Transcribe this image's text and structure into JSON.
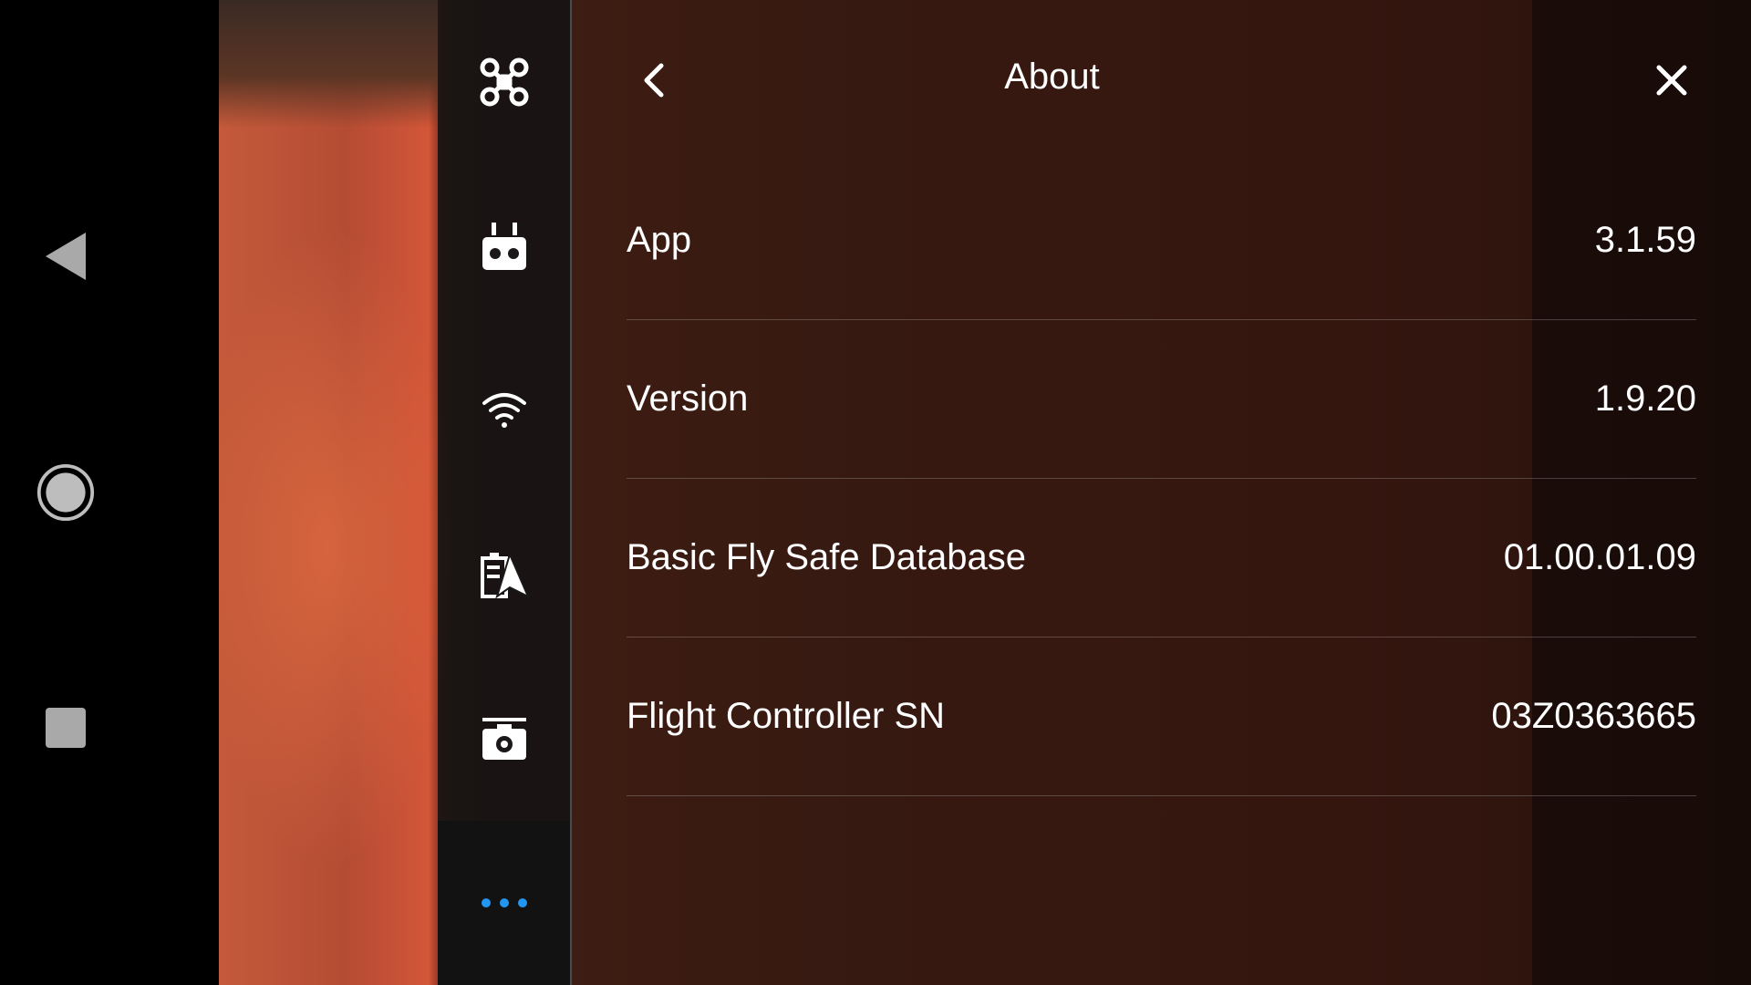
{
  "android_nav": {
    "back_icon": "triangle-back-icon",
    "home_icon": "circle-home-icon",
    "recents_icon": "square-recents-icon"
  },
  "sidebar": {
    "items": [
      {
        "icon": "drone-icon"
      },
      {
        "icon": "remote-controller-icon"
      },
      {
        "icon": "wifi-icon"
      },
      {
        "icon": "battery-flight-icon"
      },
      {
        "icon": "camera-icon"
      },
      {
        "icon": "more-dots-icon",
        "active": true
      }
    ],
    "accent": "#2196f3"
  },
  "header": {
    "title": "About",
    "back_icon": "chevron-left-icon",
    "close_icon": "close-icon"
  },
  "rows": [
    {
      "label": "App",
      "value": "3.1.59"
    },
    {
      "label": "Version",
      "value": "1.9.20"
    },
    {
      "label": "Basic Fly Safe Database",
      "value": "01.00.01.09"
    },
    {
      "label": "Flight Controller SN",
      "value": "03Z0363665"
    }
  ]
}
